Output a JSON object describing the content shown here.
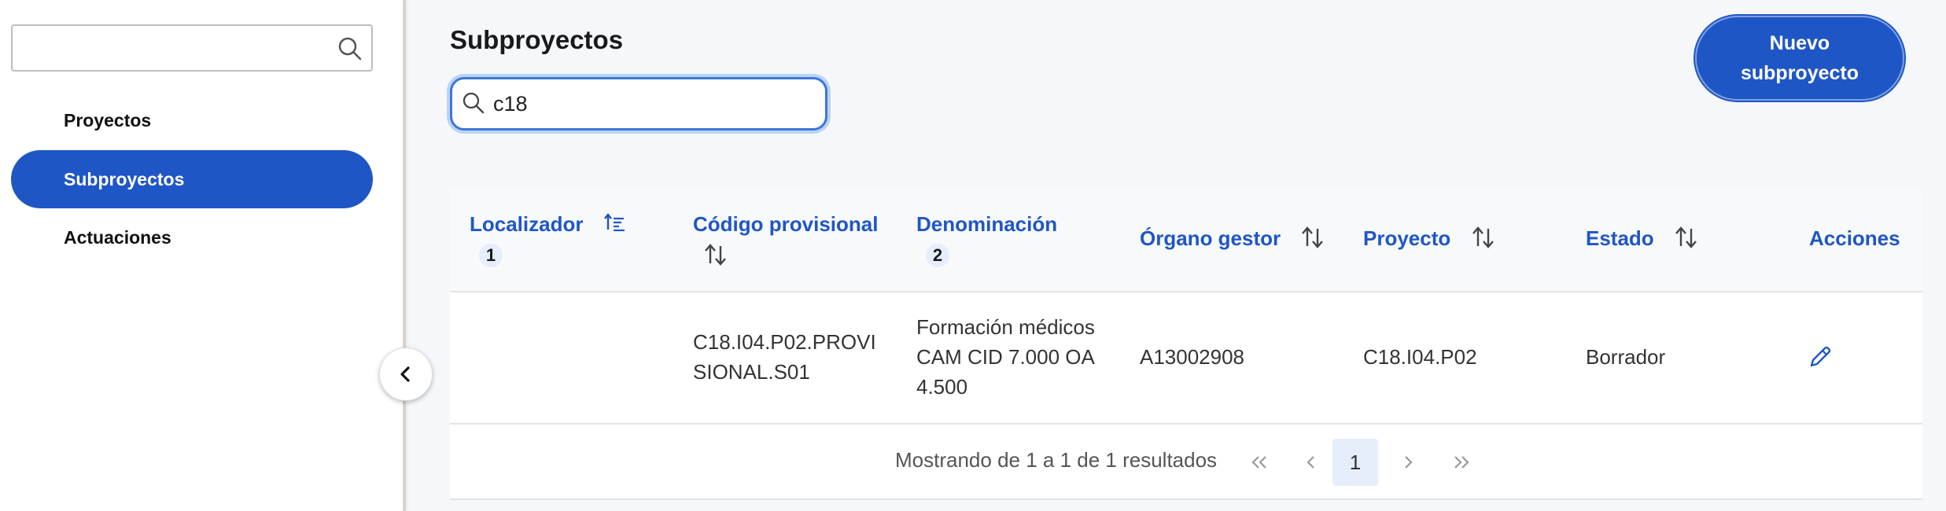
{
  "sidebar": {
    "search": {
      "value": "",
      "placeholder": ""
    },
    "items": [
      {
        "label": "Proyectos",
        "active": false
      },
      {
        "label": "Subproyectos",
        "active": true
      },
      {
        "label": "Actuaciones",
        "active": false
      }
    ]
  },
  "main": {
    "title": "Subproyectos",
    "new_button_label": "Nuevo subproyecto",
    "search": {
      "value": "c18",
      "placeholder": ""
    }
  },
  "table": {
    "columns": [
      {
        "label": "Localizador",
        "sort": "ascending",
        "sort_order": "1"
      },
      {
        "label": "Código provisional",
        "sort": "none"
      },
      {
        "label": "Denominación",
        "sort_order": "2"
      },
      {
        "label": "Órgano gestor",
        "sort": "none"
      },
      {
        "label": "Proyecto",
        "sort": "none"
      },
      {
        "label": "Estado",
        "sort": "none"
      },
      {
        "label": "Acciones"
      }
    ],
    "rows": [
      {
        "localizador": "",
        "codigo_line1": "C18.I04.P02.PROVI",
        "codigo_line2": "SIONAL.S01",
        "denominacion_line1": "Formación médicos",
        "denominacion_line2": "CAM CID 7.000 OA",
        "denominacion_line3": "4.500",
        "organo": "A13002908",
        "proyecto": "C18.I04.P02",
        "estado": "Borrador",
        "action_icon": "pencil-icon"
      }
    ]
  },
  "pagination": {
    "summary": "Mostrando de 1 a 1 de 1 resultados",
    "current_page": "1"
  },
  "colors": {
    "accent": "#1f56c6",
    "badge_bg": "#e6eefb"
  }
}
